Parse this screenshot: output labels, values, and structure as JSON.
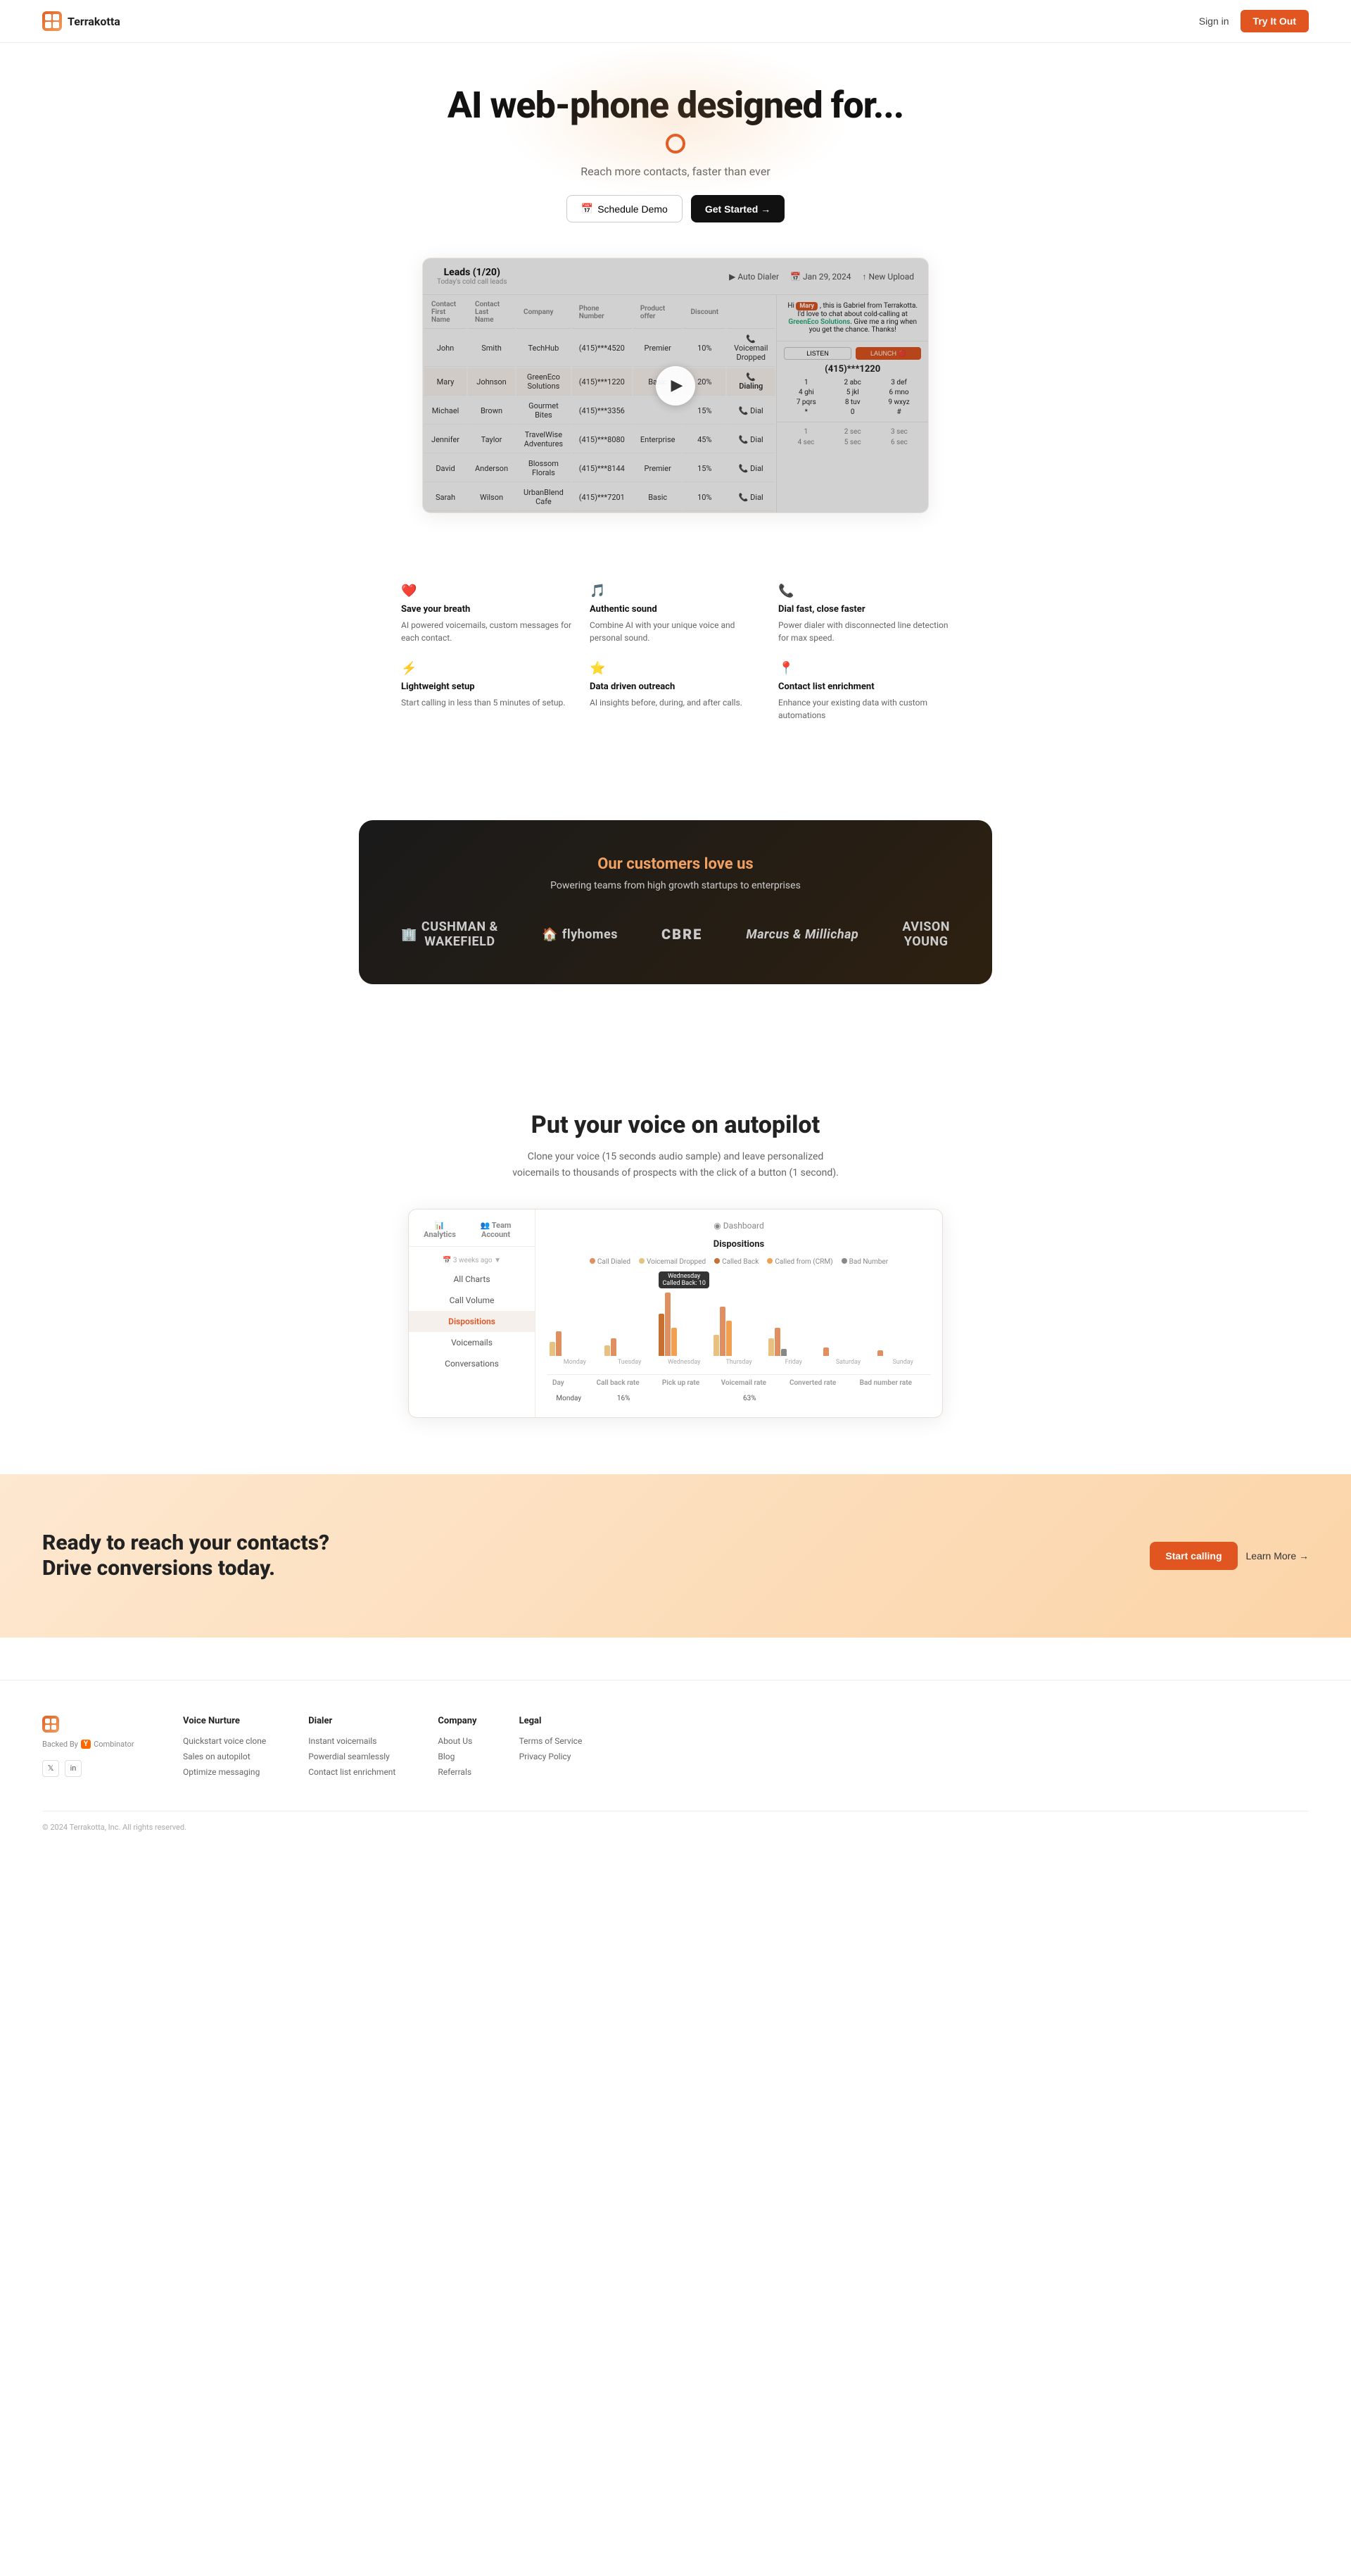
{
  "nav": {
    "brand": "Terrakotta",
    "signin": "Sign in",
    "tryit": "Try It Out"
  },
  "hero": {
    "h1": "AI web-phone designed for...",
    "sub": "Reach more contacts, faster than ever",
    "schedule": "Schedule Demo",
    "getstarted": "Get Started →"
  },
  "demo_widget": {
    "title": "Leads (1/20)",
    "subtitle": "Today's cold call leads",
    "controls": [
      "Auto Dialer",
      "Jan 29, 2024",
      "New Upload"
    ],
    "columns": [
      "Contact First Name",
      "Contact Last Name",
      "Company",
      "Phone Number",
      "Product offer",
      "Discount"
    ],
    "rows": [
      {
        "first": "John",
        "last": "Smith",
        "company": "TechHub",
        "phone": "(415)***4520",
        "product": "Premier",
        "discount": "10%",
        "status": "Voicemail Dropped"
      },
      {
        "first": "Mary",
        "last": "Johnson",
        "company": "GreenEco Solutions",
        "phone": "(415)***1220",
        "product": "Basic",
        "discount": "20%",
        "status": "Dialing",
        "active": true
      },
      {
        "first": "Michael",
        "last": "Brown",
        "company": "Gourmet Bites",
        "phone": "(415)***3356",
        "product": "",
        "discount": "15%",
        "status": "Dial"
      },
      {
        "first": "Jennifer",
        "last": "Taylor",
        "company": "TravelWise Adventures",
        "phone": "(415)***8080",
        "product": "Enterprise",
        "discount": "45%",
        "status": "Dial"
      },
      {
        "first": "David",
        "last": "Anderson",
        "company": "Blossom Florals",
        "phone": "(415)***8144",
        "product": "Premier",
        "discount": "15%",
        "status": "Dial"
      },
      {
        "first": "Sarah",
        "last": "Wilson",
        "company": "UrbanBlend Cafe",
        "phone": "(415)***7201",
        "product": "Basic",
        "discount": "10%",
        "status": "Dial"
      }
    ],
    "chat": {
      "greeting": "Hi",
      "name_tag": "Mary",
      "message": ", this is Gabriel from Terrakotta. I'd love to chat about cold-calling at",
      "company": "GreenEco Solutions",
      "message2": ". Give me a ring when you get the chance. Thanks!",
      "phone": "(415)***1220",
      "listen_label": "LISTEN",
      "launch_label": "LAUNCH"
    },
    "dialpad": {
      "number": "(415)***1220",
      "keys": [
        "1",
        "2 abc",
        "3 def",
        "4 ghi",
        "5 jkl",
        "6 mno",
        "7 pqrs",
        "8 tuv",
        "9 wxyz",
        "*",
        "0",
        "#"
      ],
      "times": [
        "1",
        "2 sec",
        "3 sec",
        "4 sec",
        "5 sec",
        "6 sec"
      ]
    }
  },
  "features": [
    {
      "icon": "❤️",
      "title": "Save your breath",
      "desc": "AI powered voicemails, custom messages for each contact."
    },
    {
      "icon": "🎵",
      "title": "Authentic sound",
      "desc": "Combine AI with your unique voice and personal sound."
    },
    {
      "icon": "📞",
      "title": "Dial fast, close faster",
      "desc": "Power dialer with disconnected line detection for max speed."
    },
    {
      "icon": "⚡",
      "title": "Lightweight setup",
      "desc": "Start calling in less than 5 minutes of setup."
    },
    {
      "icon": "⭐",
      "title": "Data driven outreach",
      "desc": "AI insights before, during, and after calls."
    },
    {
      "icon": "📍",
      "title": "Contact list enrichment",
      "desc": "Enhance your existing data with custom automations"
    }
  ],
  "customers": {
    "title": "Our customers love us",
    "sub": "Powering teams from high growth startups to enterprises",
    "logos": [
      {
        "name": "Cushman & Wakefield",
        "symbol": "🏢"
      },
      {
        "name": "flyhomes",
        "symbol": "🏠"
      },
      {
        "name": "CBRE",
        "symbol": ""
      },
      {
        "name": "Marcus & Millichap",
        "symbol": ""
      },
      {
        "name": "Avison Young",
        "symbol": ""
      }
    ]
  },
  "autopilot": {
    "title": "Put your voice on autopilot",
    "desc": "Clone your voice (15 seconds audio sample) and leave personalized voicemails to thousands of prospects with the click of a button (1 second)."
  },
  "analytics": {
    "tabs": [
      "Analytics",
      "Team Account"
    ],
    "time_filter": "3 weeks ago",
    "nav_items": [
      "All Charts",
      "Call Volume",
      "Dispositions",
      "Voicemails",
      "Conversations"
    ],
    "active_nav": "Dispositions",
    "chart_title": "Dispositions",
    "legend": [
      "Call Dialed",
      "Voicemail Dropped",
      "Called Back",
      "Called from (CRM)",
      "Bad Number"
    ],
    "legend_colors": [
      "#e09060",
      "#e8c080",
      "#c87030",
      "#f0a050",
      "#888"
    ],
    "chart_days": [
      "Monday",
      "Tuesday",
      "Wednesday",
      "Thursday",
      "Friday",
      "Saturday",
      "Sunday"
    ],
    "tooltip": {
      "day": "Wednesday",
      "label": "Called Back: 10"
    },
    "table_headers": [
      "Day",
      "Call back rate",
      "Pick up rate",
      "Voicemail rate",
      "Converted rate",
      "Bad number rate"
    ],
    "table_rows": [
      {
        "day": "Monday",
        "cb": "16%",
        "pickup": "",
        "vm": "63%",
        "converted": "",
        "bad": ""
      }
    ]
  },
  "cta": {
    "heading_line1": "Ready to reach your contacts?",
    "heading_line2": "Drive conversions today.",
    "btn_start": "Start calling",
    "btn_learn": "Learn More →"
  },
  "footer": {
    "brand": "Terrakotta",
    "backed_text": "Backed By",
    "yc_label": "Y Combinator",
    "social": [
      "𝕏",
      "in"
    ],
    "columns": [
      {
        "title": "Voice Nurture",
        "links": [
          "Quickstart voice clone",
          "Sales on autopilot",
          "Optimize messaging"
        ]
      },
      {
        "title": "Dialer",
        "links": [
          "Instant voicemails",
          "Powerdial seamlessly",
          "Contact list enrichment"
        ]
      },
      {
        "title": "Company",
        "links": [
          "About Us",
          "Blog",
          "Referrals"
        ]
      },
      {
        "title": "Legal",
        "links": [
          "Terms of Service",
          "Privacy Policy"
        ]
      }
    ],
    "copyright": "© 2024 Terrakotta, Inc. All rights reserved."
  }
}
